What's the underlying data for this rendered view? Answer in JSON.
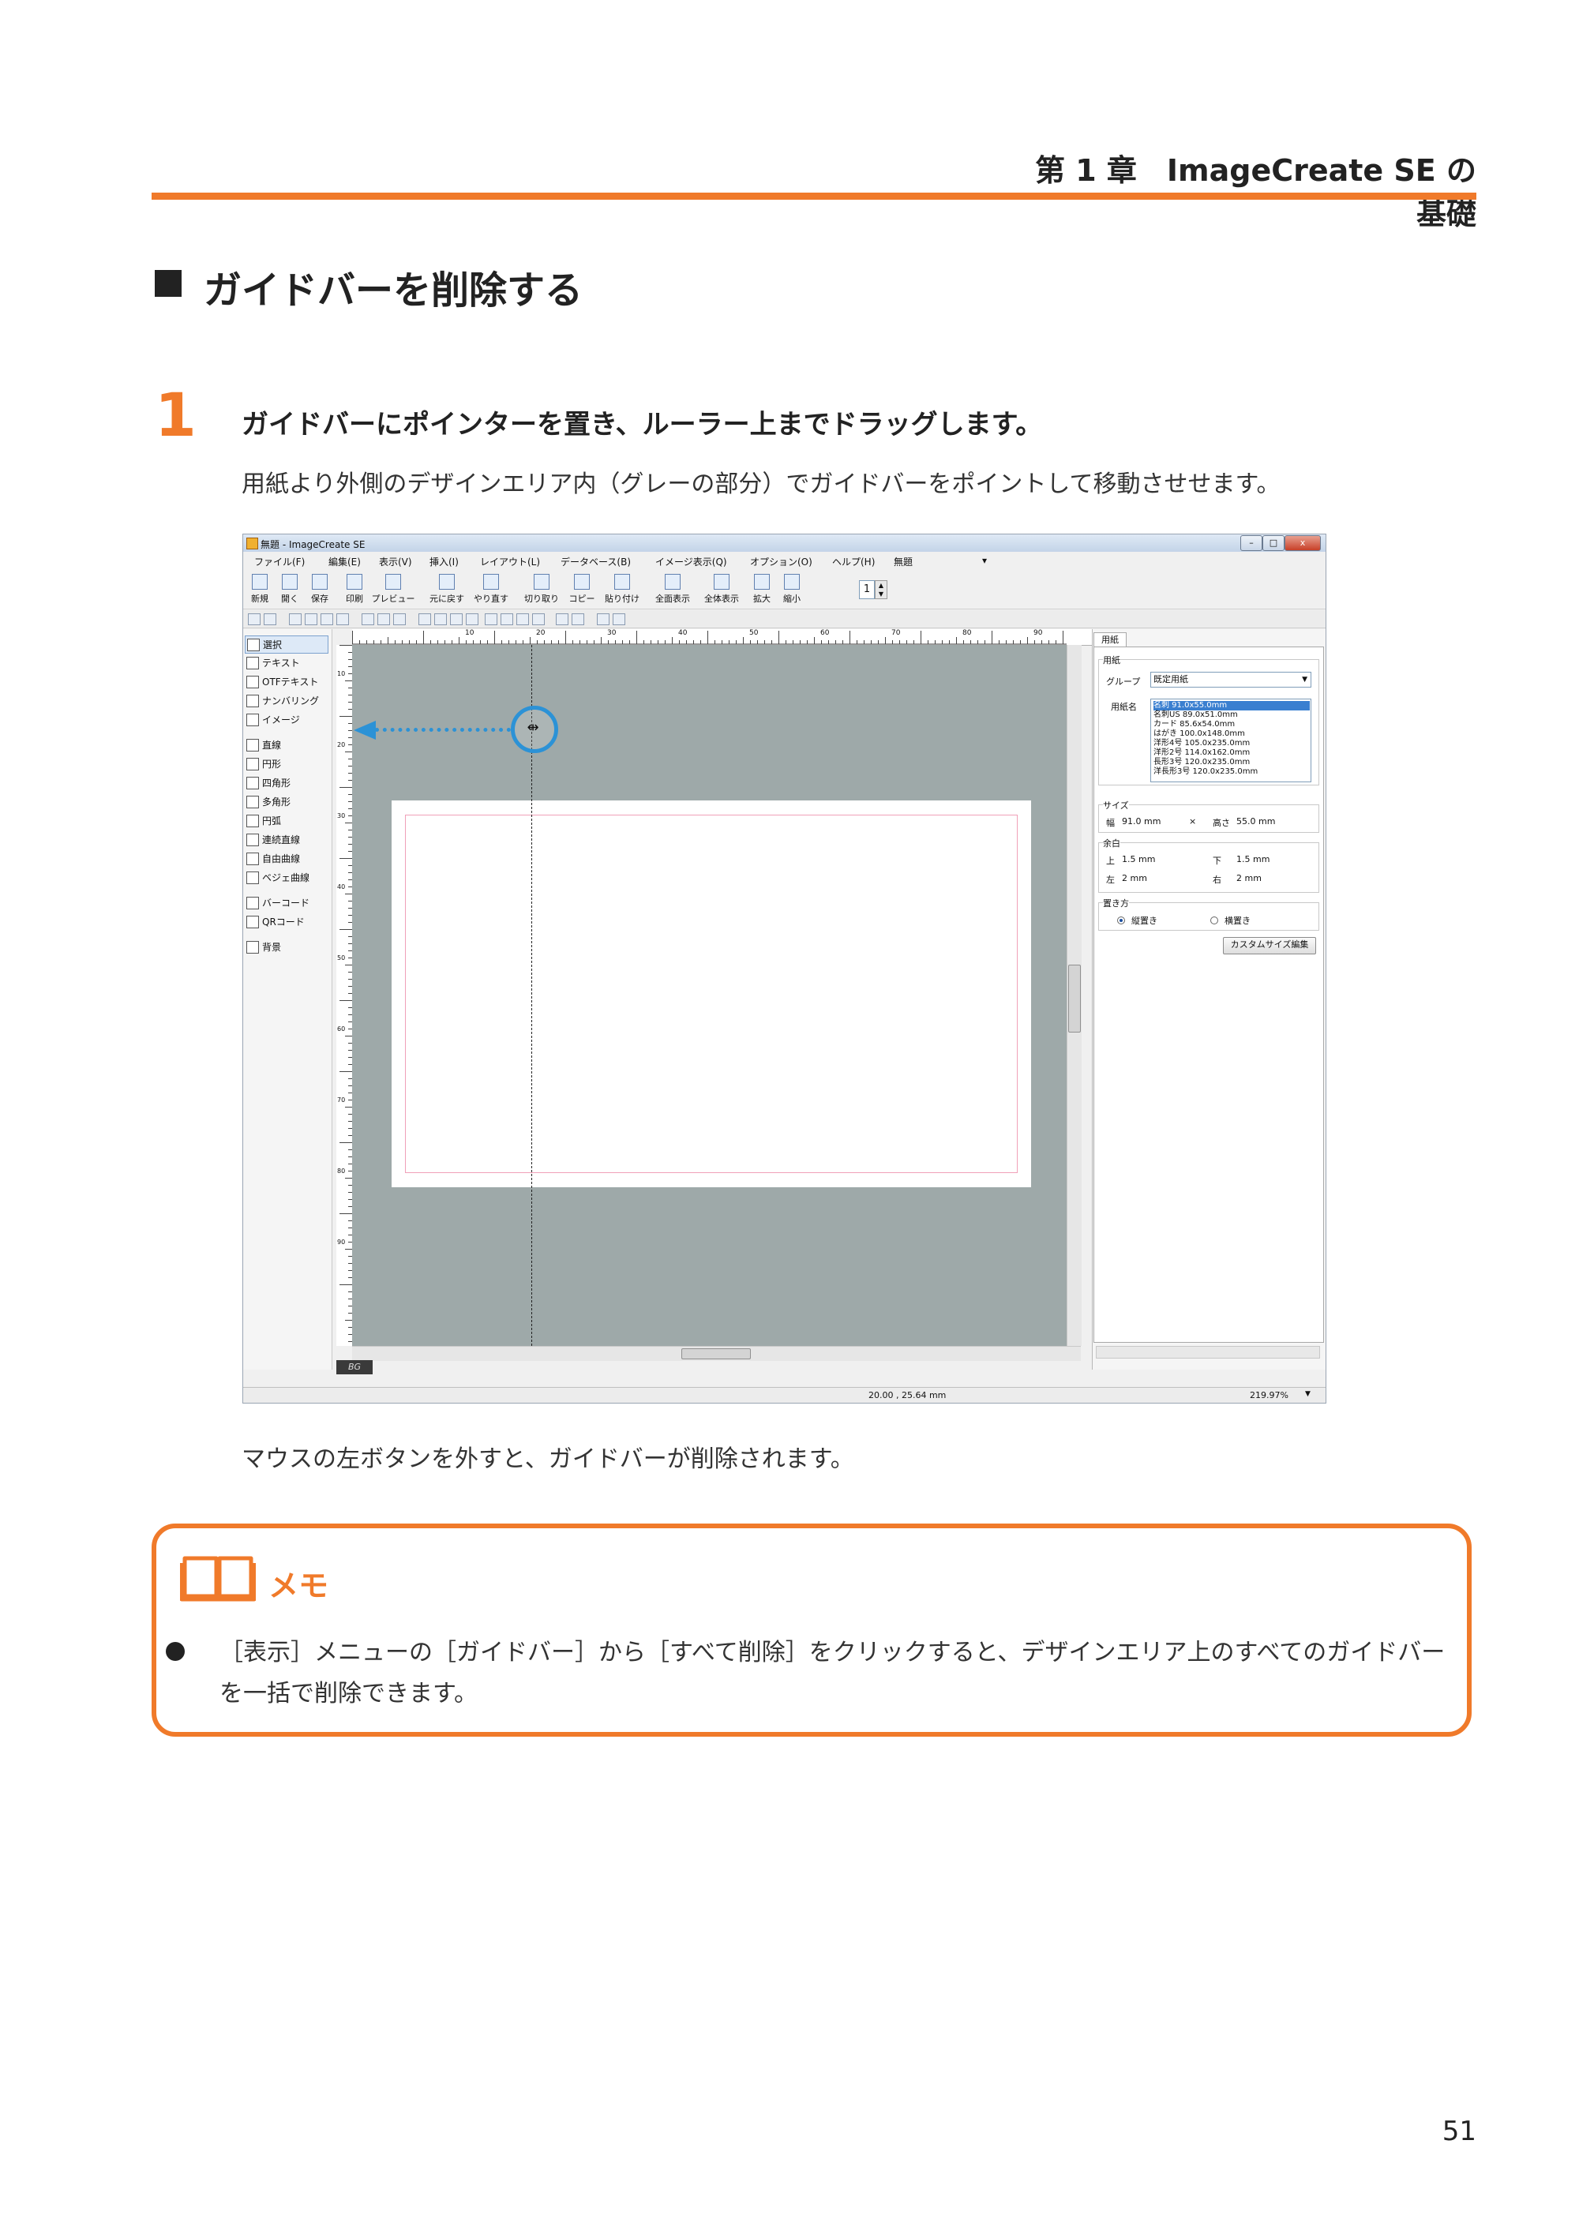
{
  "header": {
    "chapter": "第 1 章　ImageCreate SE の基礎"
  },
  "section": {
    "title": "ガイドバーを削除する"
  },
  "step": {
    "number": "1",
    "title": "ガイドバーにポインターを置き、ルーラー上までドラッグします。",
    "description": "用紙より外側のデザインエリア内（グレーの部分）でガイドバーをポイントして移動させせます。"
  },
  "after_text": "マウスの左ボタンを外すと、ガイドバーが削除されます。",
  "memo": {
    "label": "メモ",
    "text": "［表示］メニューの［ガイドバー］から［すべて削除］をクリックすると、デザインエリア上のすべてのガイドバーを一括で削除できます。"
  },
  "page_number": "51",
  "app": {
    "title": "無題 - ImageCreate SE",
    "window_buttons": [
      "–",
      "□",
      "x"
    ],
    "menu": [
      "ファイル(F)",
      "編集(E)",
      "表示(V)",
      "挿入(I)",
      "レイアウト(L)",
      "データベース(B)",
      "イメージ表示(Q)",
      "オプション(O)",
      "ヘルプ(H)",
      "無題"
    ],
    "toolbar": [
      "新規",
      "開く",
      "保存",
      "印刷",
      "プレビュー",
      "元に戻す",
      "やり直す",
      "切り取り",
      "コピー",
      "貼り付け",
      "全面表示",
      "全体表示",
      "拡大",
      "縮小"
    ],
    "page_spinner": "1",
    "tools": [
      "選択",
      "テキスト",
      "OTFテキスト",
      "ナンバリング",
      "イメージ",
      "直線",
      "円形",
      "四角形",
      "多角形",
      "円弧",
      "連続直線",
      "自由曲線",
      "ベジェ曲線",
      "バーコード",
      "QRコード",
      "背景"
    ],
    "ruler_top": [
      "10",
      "20",
      "30",
      "40",
      "50",
      "60",
      "70",
      "80",
      "90"
    ],
    "ruler_left": [
      "10",
      "20",
      "30",
      "40",
      "50",
      "60",
      "70",
      "80",
      "90"
    ],
    "background_badge": "BG",
    "status": {
      "coords": "20.00 , 25.64 mm",
      "zoom": "219.97%"
    },
    "panel": {
      "tab": "用紙",
      "paper_group_title": "用紙",
      "group_label": "グループ",
      "group_value": "既定用紙",
      "name_label": "用紙名",
      "paper_list": [
        "名刺 91.0x55.0mm",
        "名刺US 89.0x51.0mm",
        "カード 85.6x54.0mm",
        "はがき 100.0x148.0mm",
        "洋形4号 105.0x235.0mm",
        "洋形2号 114.0x162.0mm",
        "長形3号 120.0x235.0mm",
        "洋長形3号 120.0x235.0mm"
      ],
      "selected_paper_index": 0,
      "size_title": "サイズ",
      "width_label": "幅",
      "width_value": "91.0 mm",
      "times": "×",
      "height_label": "高さ",
      "height_value": "55.0 mm",
      "margin_title": "余白",
      "top_label": "上",
      "top_value": "1.5 mm",
      "bottom_label": "下",
      "bottom_value": "1.5 mm",
      "left_label": "左",
      "left_value": "2 mm",
      "right_label": "右",
      "right_value": "2 mm",
      "orientation_title": "置き方",
      "portrait": "縦置き",
      "landscape": "横置き",
      "orientation_selected": "縦置き",
      "custom_button": "カスタムサイズ編集"
    }
  },
  "colors": {
    "accent": "#f07a2a",
    "drag_arrow": "#2c92d6",
    "canvas_gray": "#9ea9a9"
  }
}
